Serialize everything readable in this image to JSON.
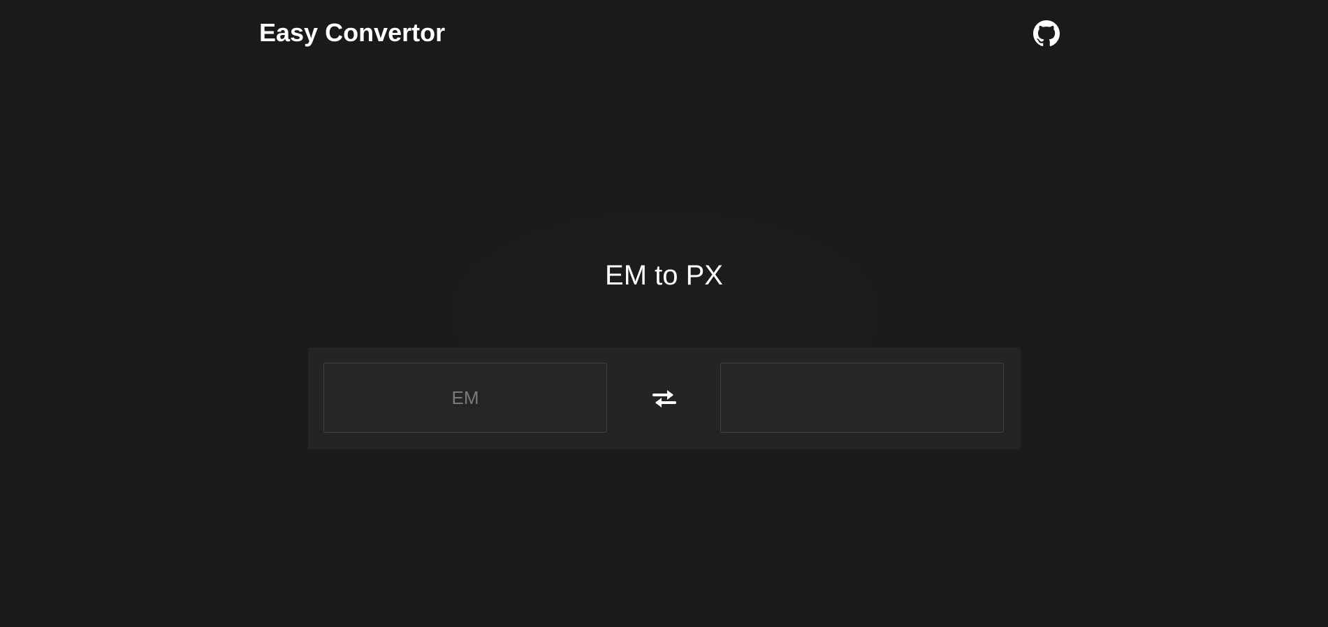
{
  "header": {
    "app_title": "Easy Convertor",
    "github_icon": "github-icon"
  },
  "main": {
    "page_title": "EM to PX",
    "converter": {
      "from_field": {
        "placeholder": "EM",
        "value": ""
      },
      "swap_icon": "swap-arrows-icon",
      "to_field": {
        "placeholder": "",
        "value": ""
      }
    }
  },
  "colors": {
    "background": "#1b1a1a",
    "panel": "#252423",
    "text": "#ffffff",
    "placeholder": "#7c7a78"
  }
}
